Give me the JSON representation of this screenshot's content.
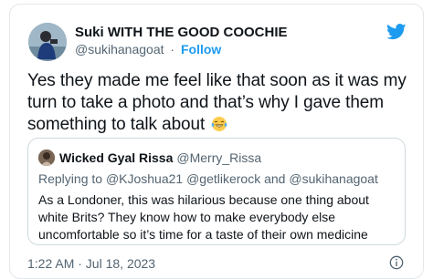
{
  "tweet": {
    "display_name": "Suki WITH THE GOOD COOCHIE",
    "handle": "@sukihanagoat",
    "separator": "·",
    "follow_label": "Follow",
    "text": "Yes they made me feel like that soon as it was my turn to take a photo and that’s why I gave them something to talk about",
    "emoji": "face-with-tears-of-joy",
    "timestamp": "1:22 AM · Jul 18, 2023"
  },
  "quoted": {
    "display_name": "Wicked Gyal Rissa",
    "handle": "@Merry_Rissa",
    "reply_prefix": "Replying to",
    "reply_to": "@KJoshua21 @getlikerock and @sukihanagoat",
    "text": "As a Londoner, this was hilarious because one thing about white Brits? They know how to make everybody else uncomfortable so it’s time for a taste of their own medicine"
  },
  "icons": {
    "brand": "twitter-bird-icon",
    "info": "info-icon"
  },
  "colors": {
    "accent": "#1d9bf0",
    "text": "#0f1419",
    "muted": "#536471",
    "border": "#cfd9de"
  }
}
